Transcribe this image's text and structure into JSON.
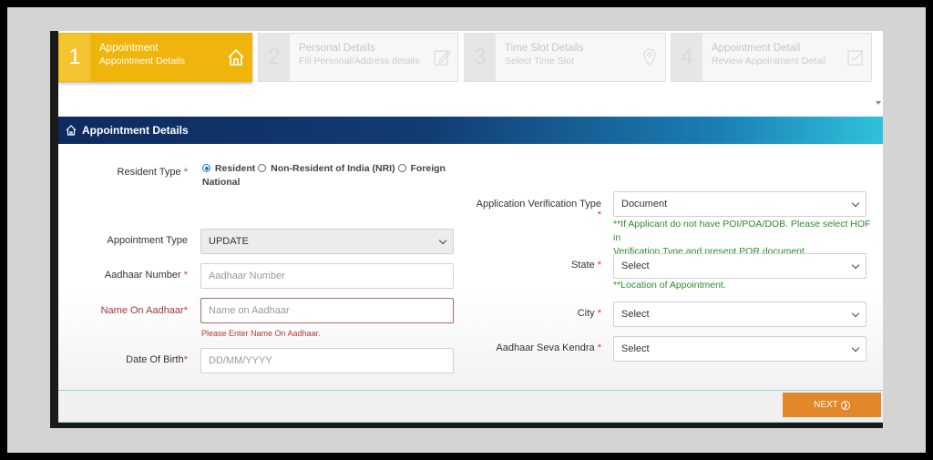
{
  "steps": [
    {
      "num": "1",
      "title": "Appointment",
      "sub": "Appointment Details",
      "icon": "home-icon",
      "active": true
    },
    {
      "num": "2",
      "title": "Personal Details",
      "sub": "Fill Personal/Address details",
      "icon": "edit-icon",
      "active": false
    },
    {
      "num": "3",
      "title": "Time Slot Details",
      "sub": "Select Time Slot",
      "icon": "location-pin-icon",
      "active": false
    },
    {
      "num": "4",
      "title": "Appointment Detail",
      "sub": "Review Appointment Detail",
      "icon": "checkbox-icon",
      "active": false
    }
  ],
  "header": {
    "title": "Appointment Details",
    "icon": "home-icon"
  },
  "form": {
    "resident_type": {
      "label": "Resident Type",
      "options": [
        "Resident",
        "Non-Resident of India (NRI)",
        "Foreign",
        "National"
      ],
      "selected": "Resident"
    },
    "appointment_type": {
      "label": "Appointment Type",
      "value": "UPDATE"
    },
    "aadhaar_number": {
      "label": "Aadhaar Number",
      "placeholder": "Aadhaar Number"
    },
    "name_on_aadhaar": {
      "label": "Name On Aadhaar",
      "placeholder": "Name on Aadhaar",
      "error": "Please Enter Name On Aadhaar."
    },
    "dob": {
      "label": "Date Of Birth",
      "placeholder": "DD/MM/YYYY"
    },
    "verification_type": {
      "label": "Application Verification Type",
      "value": "Document",
      "note_line1": "**If Applicant do not have POI/POA/DOB. Please select HOF in",
      "note_line2": "Verification Type and present POR document."
    },
    "state": {
      "label": "State",
      "value": "Select",
      "note": "**Location of Appointment."
    },
    "city": {
      "label": "City",
      "value": "Select"
    },
    "seva_kendra": {
      "label": "Aadhaar Seva Kendra",
      "value": "Select"
    },
    "required_mark": "*"
  },
  "footer": {
    "next_label": "NEXT"
  },
  "colors": {
    "active_step": "#f0b50c",
    "next_button": "#e2872a",
    "header_dark": "#0e2b5e",
    "header_light": "#2fc2dc",
    "note_green": "#2e8b2e",
    "error_red": "#b23b3b"
  }
}
